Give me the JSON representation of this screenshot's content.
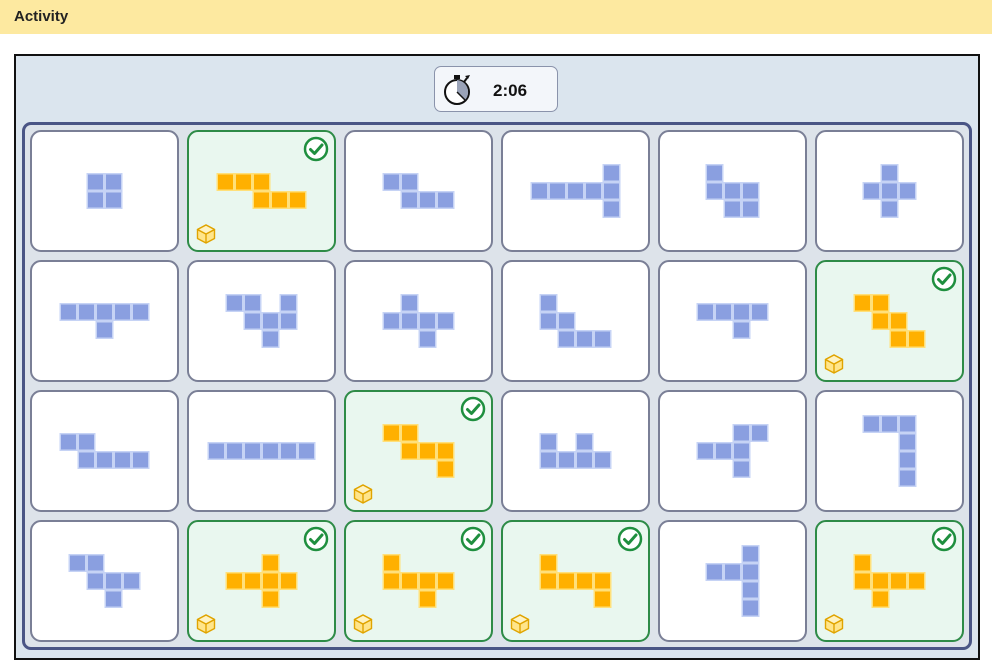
{
  "app": {
    "title": "Activity"
  },
  "timer": {
    "time": "2:06",
    "icon": "stopwatch-icon"
  },
  "colors": {
    "unsolved_fill": "#8a9fe0",
    "unsolved_stroke": "#c6d3f5",
    "solved_fill": "#ffb000",
    "solved_stroke": "#ffe07a",
    "check": "#1f8f3f"
  },
  "cards": [
    {
      "solved": false,
      "cells": [
        [
          0,
          0
        ],
        [
          1,
          0
        ],
        [
          0,
          1
        ],
        [
          1,
          1
        ]
      ]
    },
    {
      "solved": true,
      "cells": [
        [
          0,
          0
        ],
        [
          1,
          0
        ],
        [
          2,
          0
        ],
        [
          2,
          1
        ],
        [
          3,
          1
        ],
        [
          4,
          1
        ]
      ]
    },
    {
      "solved": false,
      "cells": [
        [
          0,
          0
        ],
        [
          1,
          0
        ],
        [
          1,
          1
        ],
        [
          2,
          1
        ],
        [
          3,
          1
        ]
      ]
    },
    {
      "solved": false,
      "cells": [
        [
          4,
          0
        ],
        [
          0,
          1
        ],
        [
          1,
          1
        ],
        [
          2,
          1
        ],
        [
          3,
          1
        ],
        [
          4,
          1
        ],
        [
          4,
          2
        ]
      ]
    },
    {
      "solved": false,
      "cells": [
        [
          0,
          0
        ],
        [
          0,
          1
        ],
        [
          1,
          1
        ],
        [
          2,
          1
        ],
        [
          1,
          2
        ],
        [
          2,
          2
        ]
      ]
    },
    {
      "solved": false,
      "cells": [
        [
          1,
          0
        ],
        [
          0,
          1
        ],
        [
          1,
          1
        ],
        [
          2,
          1
        ],
        [
          1,
          2
        ]
      ]
    },
    {
      "solved": false,
      "cells": [
        [
          0,
          0
        ],
        [
          1,
          0
        ],
        [
          2,
          0
        ],
        [
          3,
          0
        ],
        [
          4,
          0
        ],
        [
          2,
          1
        ]
      ]
    },
    {
      "solved": false,
      "cells": [
        [
          0,
          0
        ],
        [
          1,
          0
        ],
        [
          3,
          0
        ],
        [
          1,
          1
        ],
        [
          2,
          1
        ],
        [
          3,
          1
        ],
        [
          2,
          2
        ]
      ]
    },
    {
      "solved": false,
      "cells": [
        [
          1,
          0
        ],
        [
          0,
          1
        ],
        [
          1,
          1
        ],
        [
          2,
          1
        ],
        [
          3,
          1
        ],
        [
          2,
          2
        ]
      ]
    },
    {
      "solved": false,
      "cells": [
        [
          0,
          0
        ],
        [
          0,
          1
        ],
        [
          1,
          1
        ],
        [
          1,
          2
        ],
        [
          2,
          2
        ],
        [
          3,
          2
        ]
      ]
    },
    {
      "solved": false,
      "cells": [
        [
          0,
          0
        ],
        [
          1,
          0
        ],
        [
          2,
          0
        ],
        [
          3,
          0
        ],
        [
          2,
          1
        ]
      ]
    },
    {
      "solved": true,
      "cells": [
        [
          0,
          0
        ],
        [
          1,
          0
        ],
        [
          1,
          1
        ],
        [
          2,
          1
        ],
        [
          2,
          2
        ],
        [
          3,
          2
        ]
      ]
    },
    {
      "solved": false,
      "cells": [
        [
          0,
          0
        ],
        [
          1,
          0
        ],
        [
          1,
          1
        ],
        [
          2,
          1
        ],
        [
          3,
          1
        ],
        [
          4,
          1
        ]
      ]
    },
    {
      "solved": false,
      "cells": [
        [
          0,
          0
        ],
        [
          1,
          0
        ],
        [
          2,
          0
        ],
        [
          3,
          0
        ],
        [
          4,
          0
        ],
        [
          5,
          0
        ]
      ]
    },
    {
      "solved": true,
      "cells": [
        [
          0,
          0
        ],
        [
          1,
          0
        ],
        [
          1,
          1
        ],
        [
          2,
          1
        ],
        [
          3,
          1
        ],
        [
          3,
          2
        ]
      ]
    },
    {
      "solved": false,
      "cells": [
        [
          0,
          0
        ],
        [
          2,
          0
        ],
        [
          0,
          1
        ],
        [
          1,
          1
        ],
        [
          2,
          1
        ],
        [
          3,
          1
        ]
      ]
    },
    {
      "solved": false,
      "cells": [
        [
          2,
          0
        ],
        [
          3,
          0
        ],
        [
          0,
          1
        ],
        [
          1,
          1
        ],
        [
          2,
          1
        ],
        [
          2,
          2
        ]
      ]
    },
    {
      "solved": false,
      "cells": [
        [
          0,
          0
        ],
        [
          1,
          0
        ],
        [
          2,
          0
        ],
        [
          2,
          1
        ],
        [
          2,
          2
        ],
        [
          2,
          3
        ]
      ]
    },
    {
      "solved": false,
      "cells": [
        [
          0,
          0
        ],
        [
          1,
          0
        ],
        [
          1,
          1
        ],
        [
          2,
          1
        ],
        [
          3,
          1
        ],
        [
          2,
          2
        ]
      ]
    },
    {
      "solved": true,
      "cells": [
        [
          2,
          0
        ],
        [
          0,
          1
        ],
        [
          1,
          1
        ],
        [
          2,
          1
        ],
        [
          3,
          1
        ],
        [
          2,
          2
        ]
      ]
    },
    {
      "solved": true,
      "cells": [
        [
          0,
          0
        ],
        [
          0,
          1
        ],
        [
          1,
          1
        ],
        [
          2,
          1
        ],
        [
          3,
          1
        ],
        [
          2,
          2
        ]
      ]
    },
    {
      "solved": true,
      "cells": [
        [
          0,
          0
        ],
        [
          0,
          1
        ],
        [
          1,
          1
        ],
        [
          2,
          1
        ],
        [
          3,
          1
        ],
        [
          3,
          2
        ]
      ]
    },
    {
      "solved": false,
      "cells": [
        [
          2,
          0
        ],
        [
          0,
          1
        ],
        [
          1,
          1
        ],
        [
          2,
          1
        ],
        [
          2,
          2
        ],
        [
          2,
          3
        ]
      ]
    },
    {
      "solved": true,
      "cells": [
        [
          0,
          0
        ],
        [
          0,
          1
        ],
        [
          1,
          1
        ],
        [
          2,
          1
        ],
        [
          3,
          1
        ],
        [
          1,
          2
        ]
      ]
    }
  ]
}
